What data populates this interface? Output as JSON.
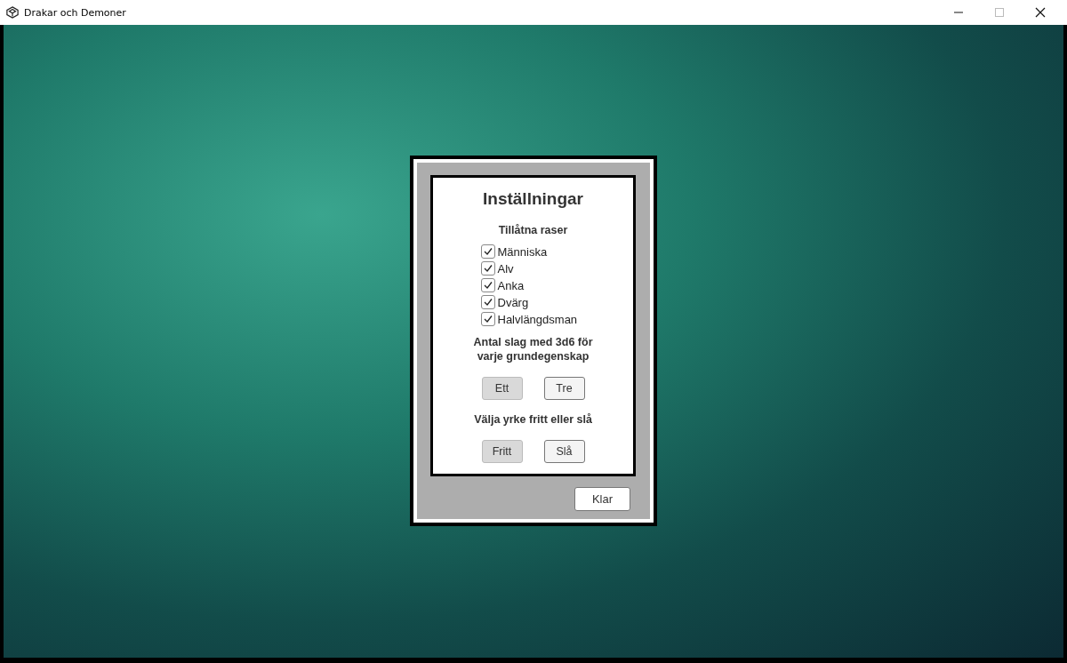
{
  "window": {
    "title": "Drakar och Demoner"
  },
  "dialog": {
    "title": "Inställningar",
    "races": {
      "heading": "Tillåtna raser",
      "items": [
        {
          "label": "Människa",
          "checked": true
        },
        {
          "label": "Alv",
          "checked": true
        },
        {
          "label": "Anka",
          "checked": true
        },
        {
          "label": "Dvärg",
          "checked": true
        },
        {
          "label": "Halvlängdsman",
          "checked": true
        }
      ]
    },
    "rolls": {
      "heading": "Antal slag med 3d6 för varje grundegenskap",
      "options": [
        {
          "label": "Ett",
          "selected": true
        },
        {
          "label": "Tre",
          "selected": false
        }
      ]
    },
    "profession": {
      "heading": "Välja yrke fritt eller slå",
      "options": [
        {
          "label": "Fritt",
          "selected": true
        },
        {
          "label": "Slå",
          "selected": false
        }
      ]
    },
    "done_button": "Klar"
  }
}
